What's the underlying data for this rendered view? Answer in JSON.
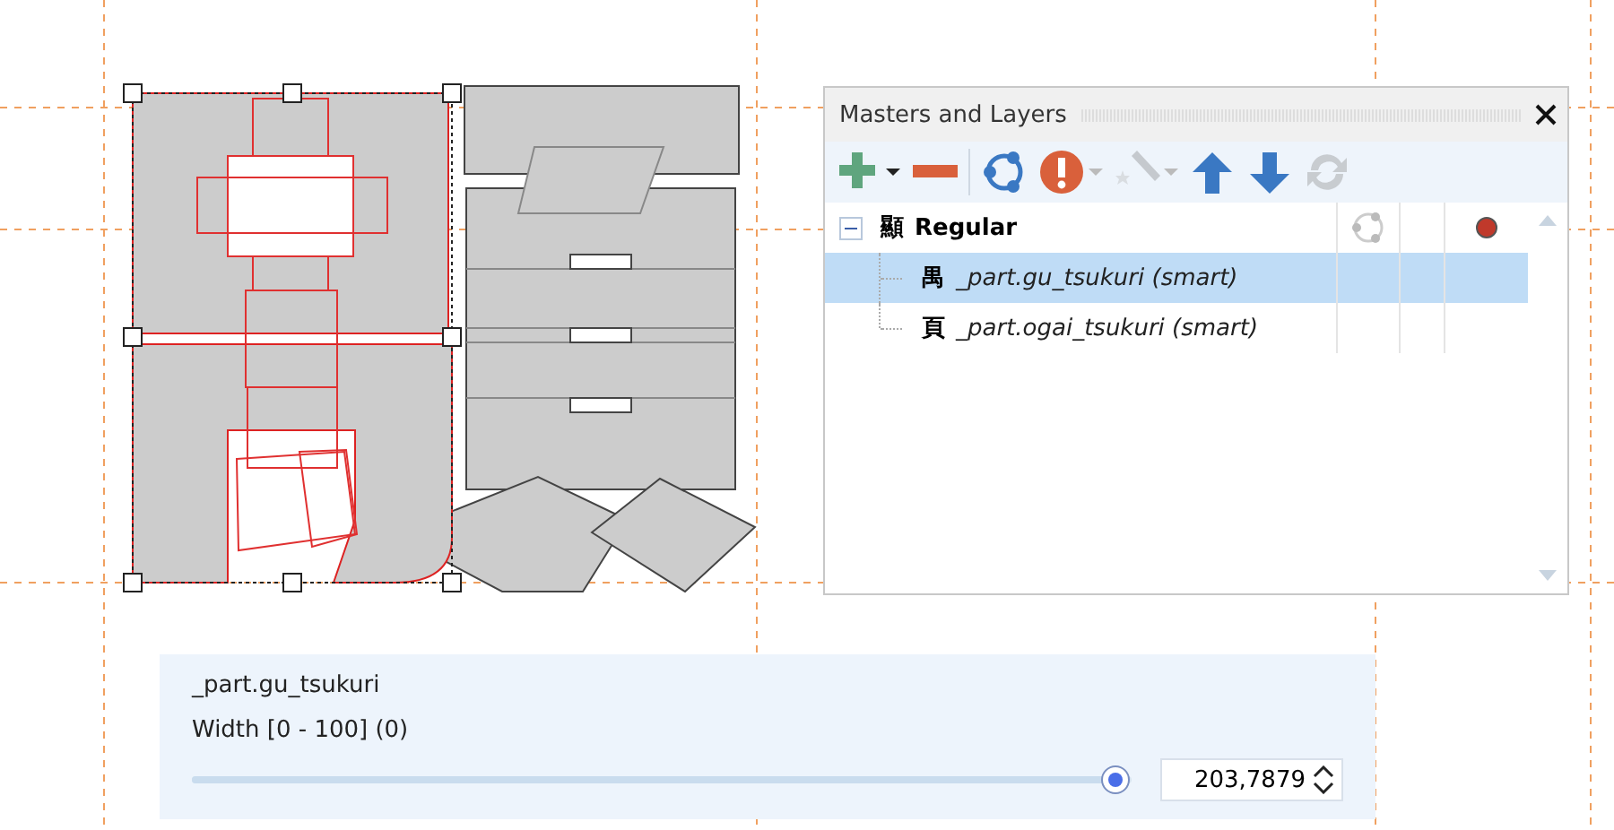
{
  "panel": {
    "title": "Masters and Layers",
    "toolbar": [
      {
        "kind": "add",
        "disabled": false,
        "dropdown": true
      },
      {
        "kind": "remove",
        "disabled": false,
        "dropdown": false
      },
      {
        "kind": "sync",
        "disabled": false,
        "dropdown": false
      },
      {
        "kind": "warning",
        "disabled": false,
        "dropdown": true
      },
      {
        "kind": "wand",
        "disabled": true,
        "dropdown": true
      },
      {
        "kind": "up",
        "disabled": false,
        "dropdown": false
      },
      {
        "kind": "down",
        "disabled": false,
        "dropdown": false
      },
      {
        "kind": "refresh",
        "disabled": true,
        "dropdown": false
      }
    ],
    "master": {
      "glyph": "顯",
      "name": "Regular",
      "expanded": true,
      "color": "#c0392b",
      "children": [
        {
          "glyph": "禺",
          "name": "_part.gu_tsukuri (smart)",
          "selected": true
        },
        {
          "glyph": "頁",
          "name": "_part.ogai_tsukuri (smart)",
          "selected": false
        }
      ]
    }
  },
  "axis_panel": {
    "part": "_part.gu_tsukuri",
    "axis": "Width [0 - 100] (0)",
    "level": 0.985,
    "value": "203,7879"
  }
}
